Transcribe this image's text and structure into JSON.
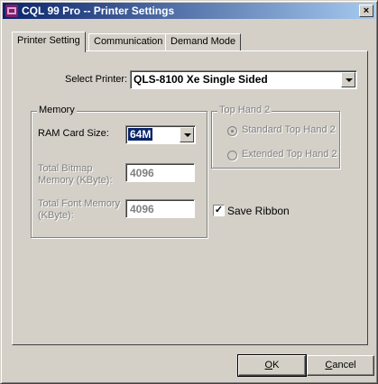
{
  "window": {
    "title": "CQL 99 Pro -- Printer Settings",
    "close_glyph": "×"
  },
  "tabs": [
    {
      "label": "Printer Setting",
      "active": true
    },
    {
      "label": "Communication",
      "active": false
    },
    {
      "label": "Demand Mode",
      "active": false
    }
  ],
  "printer": {
    "label": "Select Printer:",
    "value": "QLS-8100 Xe Single Sided"
  },
  "memory": {
    "group_title": "Memory",
    "ram_label": "RAM Card Size:",
    "ram_value": "64M",
    "bitmap_label_1": "Total Bitmap",
    "bitmap_label_2": "Memory (KByte):",
    "bitmap_value": "4096",
    "font_label_1": "Total Font Memory",
    "font_label_2": "(KByte):",
    "font_value": "4096"
  },
  "top_hand": {
    "group_title": "Top Hand 2",
    "option1": "Standard Top Hand 2",
    "option2": "Extended Top Hand 2",
    "selected": "Standard Top Hand 2",
    "enabled": false
  },
  "save_ribbon": {
    "label": "Save Ribbon",
    "checked": true,
    "mark": "✓"
  },
  "buttons": {
    "ok_mnemonic": "O",
    "ok_rest": "K",
    "cancel_mnemonic": "C",
    "cancel_rest": "ancel"
  },
  "colors": {
    "title_start": "#0a246a",
    "title_end": "#a6caf0",
    "face": "#d4d0c8",
    "selection": "#0a246a"
  }
}
